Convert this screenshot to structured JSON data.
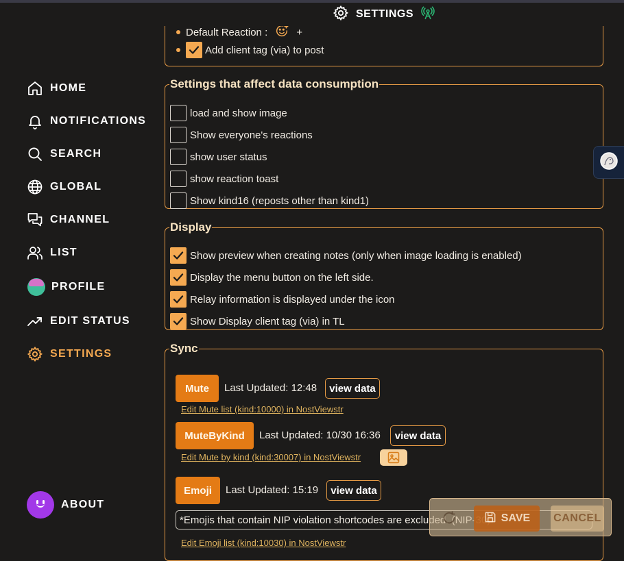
{
  "header": {
    "title": "SETTINGS",
    "icon": "gear-icon",
    "relay_icon": "antenna-icon",
    "relay_color": "#2bb673"
  },
  "sidebar": {
    "items": [
      {
        "label": "HOME",
        "icon": "home-icon"
      },
      {
        "label": "NOTIFICATIONS",
        "icon": "bell-icon"
      },
      {
        "label": "SEARCH",
        "icon": "search-icon"
      },
      {
        "label": "GLOBAL",
        "icon": "globe-icon"
      },
      {
        "label": "CHANNEL",
        "icon": "chat-icon"
      },
      {
        "label": "LIST",
        "icon": "users-icon"
      },
      {
        "label": "PROFILE",
        "icon": "avatar"
      },
      {
        "label": "EDIT STATUS",
        "icon": "trend-icon"
      },
      {
        "label": "SETTINGS",
        "icon": "gear-icon",
        "active": true
      }
    ],
    "about": {
      "label": "ABOUT",
      "icon": "avatar"
    }
  },
  "top_section": {
    "default_reaction": {
      "label": "Default Reaction :",
      "plus": "+",
      "icon": "smiley-plus-icon"
    },
    "client_tag": {
      "label": "Add client tag (via) to post",
      "checked": true
    }
  },
  "data_consumption": {
    "legend": "Settings that affect data consumption",
    "options": [
      {
        "label": "load and show image",
        "checked": false
      },
      {
        "label": "Show everyone's reactions",
        "checked": false
      },
      {
        "label": "show user status",
        "checked": false
      },
      {
        "label": "show reaction toast",
        "checked": false
      },
      {
        "label": "Show kind16 (reposts other than kind1)",
        "checked": false
      }
    ]
  },
  "display": {
    "legend": "Display",
    "options": [
      {
        "label": "Show preview when creating notes (only when image loading is enabled)",
        "checked": true
      },
      {
        "label": "Display the menu button on the left side.",
        "checked": true
      },
      {
        "label": "Relay information is displayed under the icon",
        "checked": true
      },
      {
        "label": "Show Display client tag (via) in TL",
        "checked": true
      }
    ]
  },
  "sync": {
    "legend": "Sync",
    "mute": {
      "button": "Mute",
      "updated": "Last Updated: 12:48",
      "view": "view data",
      "link": "Edit Mute list (kind:10000) in NostViewstr"
    },
    "mutebykind": {
      "button": "MuteByKind",
      "updated": "Last Updated: 10/30 16:36",
      "view": "view data",
      "link": "Edit Mute by kind (kind:30007) in NostViewstr"
    },
    "emoji": {
      "button": "Emoji",
      "updated": "Last Updated: 15:19",
      "view": "view data",
      "note": "*Emojis that contain NIP violation shortcodes are excluded. (NIP-30)",
      "link": "Edit Emoji list (kind:10030) in NostViewstr"
    }
  },
  "savebar": {
    "save": "SAVE",
    "cancel": "CANCEL"
  },
  "colors": {
    "accent": "#f5a951",
    "button": "#e47b15",
    "border": "#e59a45",
    "background": "#1c1b1a"
  }
}
